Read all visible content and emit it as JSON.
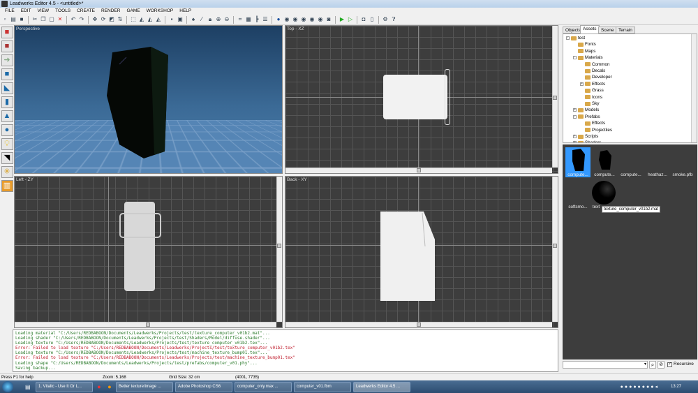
{
  "window": {
    "title": "Leadwerks Editor 4.5 - <untitled>*"
  },
  "menu": [
    "FILE",
    "EDIT",
    "VIEW",
    "TOOLS",
    "CREATE",
    "RENDER",
    "GAME",
    "WORKSHOP",
    "HELP"
  ],
  "viewports": {
    "perspective": "Perspective",
    "top": "Top - XZ",
    "left": "Left - ZY",
    "back": "Back - XY"
  },
  "console": [
    {
      "type": "ok",
      "text": "Loading material \"C:/Users/REDBABOON/Documents/Leadwerks/Projects/test/texture_computer_v01b2.mat\"..."
    },
    {
      "type": "ok",
      "text": "Loading shader \"C:/Users/REDBABOON/Documents/Leadwerks/Projects/test/Shaders/Model/diffuse.shader\"..."
    },
    {
      "type": "ok",
      "text": "Loading texture \"C:/Users/REDBABOON/Documents/Leadwerks/Projects/test/texture_computer_v01b2.tex\"..."
    },
    {
      "type": "err",
      "text": "Error: Failed to load texture \"C:/Users/REDBABOON/Documents/Leadwerks/Projects/test/texture_computer_v01b2.tex\""
    },
    {
      "type": "ok",
      "text": "Loading texture \"C:/Users/REDBABOON/Documents/Leadwerks/Projects/test/machine_texture_bump01.tex\"..."
    },
    {
      "type": "err",
      "text": "Error: Failed to load texture \"C:/Users/REDBABOON/Documents/Leadwerks/Projects/test/machine_texture_bump01.tex\""
    },
    {
      "type": "ok",
      "text": "Loading shape \"C:/Users/REDBABOON/Documents/Leadwerks/Projects/test/prefabs/computer_v01.phy\"..."
    },
    {
      "type": "ok",
      "text": "Saving backup..."
    }
  ],
  "panel": {
    "tabs": [
      "Objects",
      "Assets",
      "Scene",
      "Terrain"
    ],
    "active_tab": "Assets",
    "tree": [
      {
        "label": "test",
        "level": 0,
        "exp": "-"
      },
      {
        "label": "Fonts",
        "level": 1
      },
      {
        "label": "Maps",
        "level": 1
      },
      {
        "label": "Materials",
        "level": 1,
        "exp": "-"
      },
      {
        "label": "Common",
        "level": 2
      },
      {
        "label": "Decals",
        "level": 2
      },
      {
        "label": "Developer",
        "level": 2
      },
      {
        "label": "Effects",
        "level": 2,
        "exp": "+"
      },
      {
        "label": "Grass",
        "level": 2
      },
      {
        "label": "Icons",
        "level": 2
      },
      {
        "label": "Sky",
        "level": 2
      },
      {
        "label": "Models",
        "level": 1,
        "exp": "+"
      },
      {
        "label": "Prefabs",
        "level": 1,
        "exp": "-"
      },
      {
        "label": "Effects",
        "level": 2
      },
      {
        "label": "Projectiles",
        "level": 2
      },
      {
        "label": "Scripts",
        "level": 1,
        "exp": "+"
      },
      {
        "label": "Shaders",
        "level": 1,
        "exp": "+"
      }
    ],
    "thumbnails": [
      "compute...",
      "compute...",
      "compute...",
      "heathaz...",
      "smoke.pfb",
      "softsmo...",
      "text"
    ],
    "tooltip": "texture_computer_v01b2.mat",
    "recursive_label": "Recursive",
    "recursive_checked": true,
    "search_value": ""
  },
  "status": {
    "help": "Press F1 for help",
    "zoom": "Zoom: 5.168",
    "grid": "Grid Size: 32 cm",
    "coords": "(4001, 7735)"
  },
  "taskbar": {
    "items": [
      "1. Vitalic - Use It Or L...",
      "Better texture/image ...",
      "Adobe Photoshop CS6",
      "computer_only.max ...",
      "computer_v01.fbm",
      "Leadwerks Editor 4.5 ..."
    ],
    "clock": "13:27"
  }
}
